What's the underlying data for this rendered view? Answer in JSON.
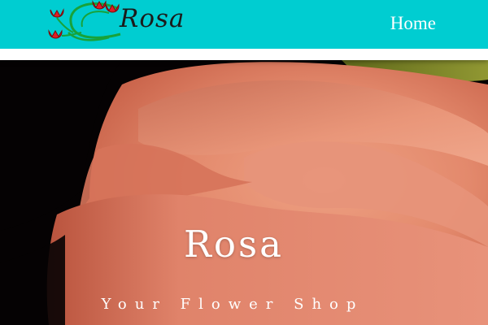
{
  "navbar": {
    "brand": "Rosa",
    "logo_icon": "tulip-logo-icon",
    "home_label": "Home",
    "background": "#00cdd1"
  },
  "hero": {
    "title": "Rosa",
    "subtitle": "Your Flower Shop",
    "image": "rose-petal-closeup"
  },
  "colors": {
    "nav": "#00cdd1",
    "rose": "#e3856a",
    "background_dark": "#050203"
  }
}
